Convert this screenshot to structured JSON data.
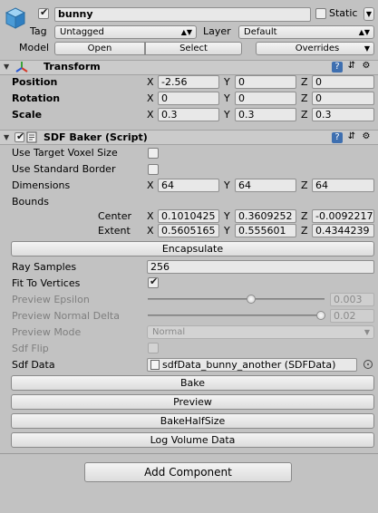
{
  "object": {
    "active": true,
    "name": "bunny",
    "static_label": "Static",
    "static_checked": false,
    "tag_label": "Tag",
    "tag_value": "Untagged",
    "layer_label": "Layer",
    "layer_value": "Default",
    "model_label": "Model",
    "open_label": "Open",
    "select_label": "Select",
    "overrides_label": "Overrides"
  },
  "transform": {
    "title": "Transform",
    "rows": [
      {
        "label": "Position",
        "x": "-2.56",
        "y": "0",
        "z": "0"
      },
      {
        "label": "Rotation",
        "x": "0",
        "y": "0",
        "z": "0"
      },
      {
        "label": "Scale",
        "x": "0.3",
        "y": "0.3",
        "z": "0.3"
      }
    ]
  },
  "axes": {
    "x": "X",
    "y": "Y",
    "z": "Z"
  },
  "sdf": {
    "title": "SDF Baker (Script)",
    "use_target_voxel_label": "Use Target Voxel Size",
    "use_target_voxel_checked": false,
    "use_standard_border_label": "Use Standard Border",
    "use_standard_border_checked": false,
    "dimensions_label": "Dimensions",
    "dimensions": {
      "x": "64",
      "y": "64",
      "z": "64"
    },
    "bounds_label": "Bounds",
    "center_label": "Center",
    "center": {
      "x": "0.1010425",
      "y": "0.3609252",
      "z": "-0.0092217"
    },
    "extent_label": "Extent",
    "extent": {
      "x": "0.5605165",
      "y": "0.555601",
      "z": "0.4344239"
    },
    "encapsulate_label": "Encapsulate",
    "ray_samples_label": "Ray Samples",
    "ray_samples": "256",
    "fit_to_vertices_label": "Fit To Vertices",
    "fit_to_vertices_checked": true,
    "preview_epsilon_label": "Preview Epsilon",
    "preview_epsilon": "0.003",
    "preview_epsilon_slider_fraction": 0.6,
    "preview_normal_delta_label": "Preview Normal Delta",
    "preview_normal_delta": "0.02",
    "preview_normal_delta_slider_fraction": 1.0,
    "preview_mode_label": "Preview Mode",
    "preview_mode": "Normal",
    "sdf_flip_label": "Sdf Flip",
    "sdf_flip_checked": false,
    "sdf_data_label": "Sdf Data",
    "sdf_data_value": "sdfData_bunny_another (SDFData)",
    "bake_label": "Bake",
    "preview_label": "Preview",
    "bake_half_size_label": "BakeHalfSize",
    "log_volume_label": "Log Volume Data"
  },
  "add_component_label": "Add Component",
  "icons": [
    "gameobject-cube-icon",
    "transform-axes-icon",
    "script-icon",
    "help-book-icon",
    "preset-sliders-icon",
    "settings-gear-icon",
    "object-picker-icon"
  ]
}
